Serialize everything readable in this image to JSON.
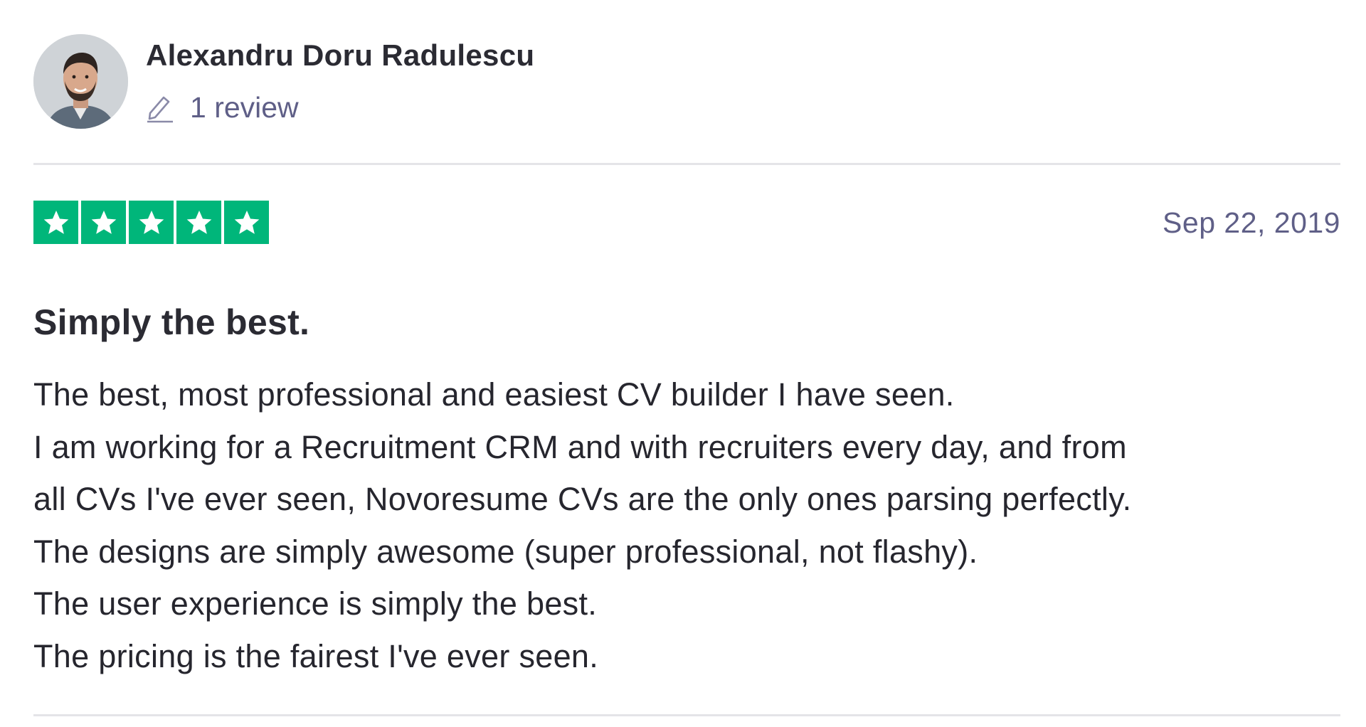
{
  "reviewer": {
    "name": "Alexandru Doru Radulescu",
    "review_count": "1 review",
    "avatar_icon": "user-photo"
  },
  "review": {
    "rating": 5,
    "max_rating": 5,
    "star_color": "#00b67a",
    "date": "Sep 22, 2019",
    "title": "Simply the best.",
    "body_lines": [
      "The best, most professional and easiest CV builder I have seen.",
      "I am working for a Recruitment CRM and with recruiters every day, and from",
      "all CVs I've ever seen, Novoresume CVs are the only ones parsing perfectly.",
      "The designs are simply awesome (super professional, not flashy).",
      "The user experience is simply the best.",
      "The pricing is the fairest I've ever seen."
    ]
  }
}
